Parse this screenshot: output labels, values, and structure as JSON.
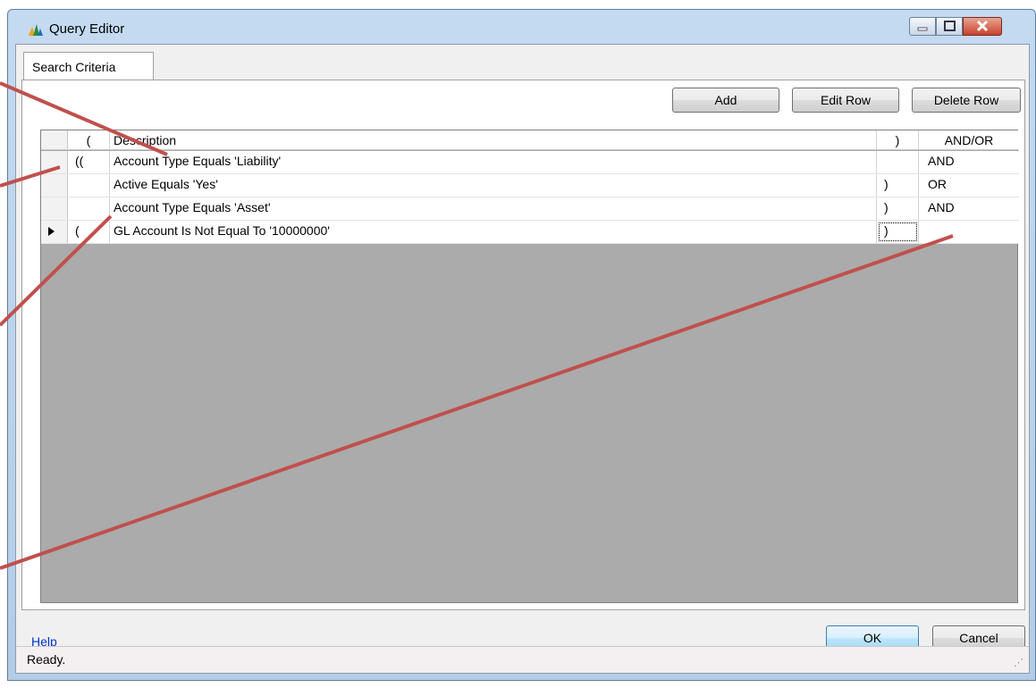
{
  "window": {
    "title": "Query Editor",
    "minimize_icon": "minimize-icon",
    "maximize_icon": "maximize-icon",
    "close_icon": "close-icon"
  },
  "tabs": [
    {
      "label": "Search Criteria"
    }
  ],
  "toolbar": {
    "add_label": "Add",
    "edit_label": "Edit Row",
    "delete_label": "Delete Row"
  },
  "grid": {
    "headers": [
      "(",
      "Description",
      ")",
      "AND/OR"
    ],
    "rows": [
      {
        "open": "((",
        "description": "Account Type Equals 'Liability'",
        "close": "",
        "op": "AND"
      },
      {
        "open": "",
        "description": "Active Equals 'Yes'",
        "close": ")",
        "op": "OR"
      },
      {
        "open": "",
        "description": "Account Type Equals 'Asset'",
        "close": ")",
        "op": "AND"
      },
      {
        "open": "(",
        "description": "GL Account Is Not Equal To '10000000'",
        "close": ")",
        "op": ""
      }
    ]
  },
  "footer": {
    "help_label": "Help",
    "ok_label": "OK",
    "cancel_label": "Cancel"
  },
  "status": {
    "text": "Ready."
  },
  "colors": {
    "annotation_line": "#c0504d",
    "grid_empty": "#ababab"
  }
}
